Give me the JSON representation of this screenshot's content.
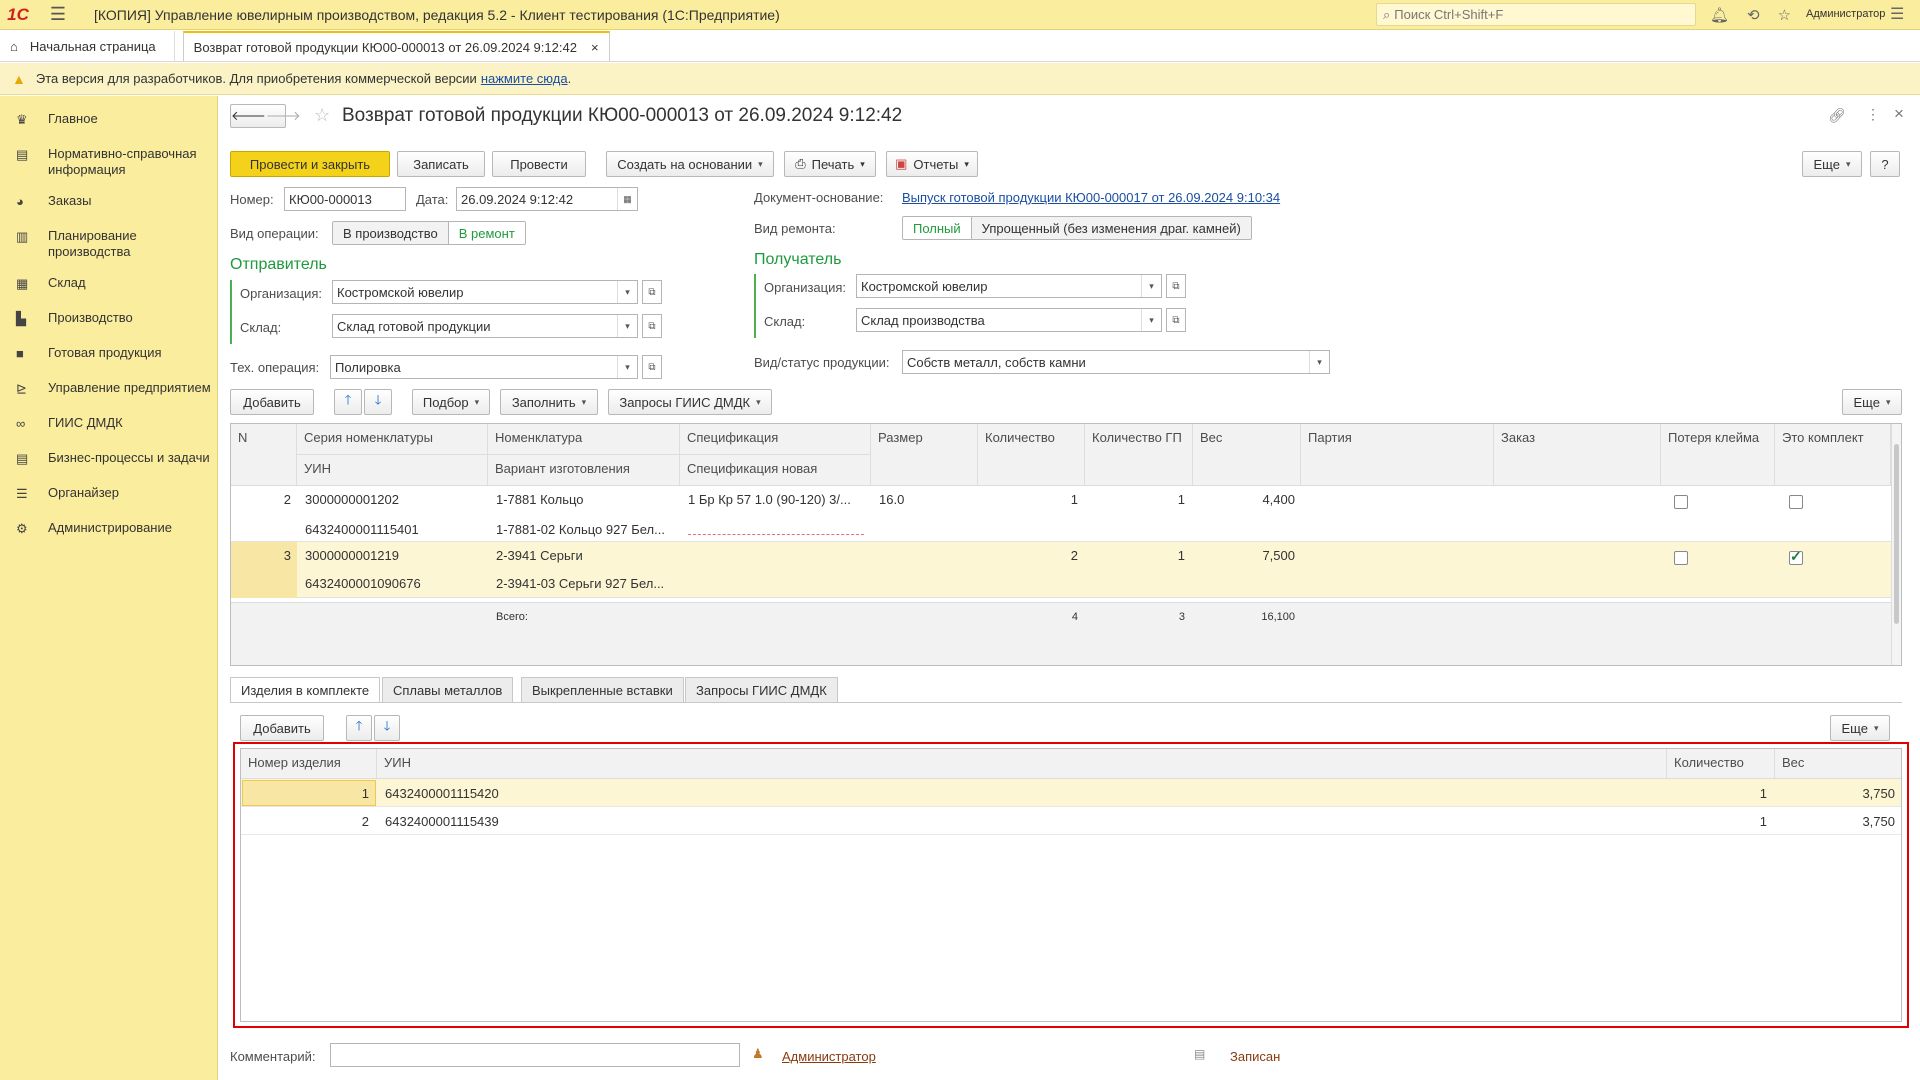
{
  "app": {
    "logo": "1С",
    "title": "[КОПИЯ] Управление ювелирным производством, редакция 5.2  - Клиент тестирования (1С:Предприятие)",
    "search_placeholder": "Поиск Ctrl+Shift+F",
    "user": "Администратор"
  },
  "tabs": {
    "home": "Начальная страница",
    "doc": "Возврат готовой продукции КЮ00-000013 от 26.09.2024 9:12:42"
  },
  "warning": {
    "text": "Эта версия для разработчиков. Для приобретения коммерческой версии",
    "link": "нажмите сюда",
    "dot": "."
  },
  "sidebar": {
    "items": [
      {
        "label": "Главное",
        "icon": "crown-icon"
      },
      {
        "label": "Нормативно-справочная информация",
        "icon": "book-icon"
      },
      {
        "label": "Заказы",
        "icon": "pie-icon"
      },
      {
        "label": "Планирование производства",
        "icon": "clipboard-icon"
      },
      {
        "label": "Склад",
        "icon": "grid-icon"
      },
      {
        "label": "Производство",
        "icon": "factory-icon"
      },
      {
        "label": "Готовая продукция",
        "icon": "bag-icon"
      },
      {
        "label": "Управление предприятием",
        "icon": "chart-icon"
      },
      {
        "label": "ГИИС ДМДК",
        "icon": "link-icon"
      },
      {
        "label": "Бизнес-процессы и задачи",
        "icon": "building-icon"
      },
      {
        "label": "Органайзер",
        "icon": "list-icon"
      },
      {
        "label": "Администрирование",
        "icon": "gear-icon"
      }
    ]
  },
  "doc": {
    "title": "Возврат готовой продукции КЮ00-000013 от 26.09.2024 9:12:42"
  },
  "toolbar": {
    "post_close": "Провести и закрыть",
    "save": "Записать",
    "post": "Провести",
    "create_based": "Создать на основании",
    "print": "Печать",
    "reports": "Отчеты",
    "more": "Еще",
    "help": "?"
  },
  "header": {
    "number_label": "Номер:",
    "number": "КЮ00-000013",
    "date_label": "Дата:",
    "date": "26.09.2024  9:12:42",
    "op_label": "Вид операции:",
    "op_options": [
      "В производство",
      "В ремонт"
    ],
    "base_label": "Документ-основание:",
    "base_link": "Выпуск готовой продукции КЮ00-000017 от 26.09.2024 9:10:34",
    "repair_label": "Вид ремонта:",
    "repair_options": [
      "Полный",
      "Упрощенный (без изменения драг. камней)"
    ]
  },
  "sender": {
    "title": "Отправитель",
    "org_label": "Организация:",
    "org": "Костромской ювелир",
    "wh_label": "Склад:",
    "wh": "Склад готовой продукции"
  },
  "receiver": {
    "title": "Получатель",
    "org_label": "Организация:",
    "org": "Костромской ювелир",
    "wh_label": "Склад:",
    "wh": "Склад производства"
  },
  "techop": {
    "label": "Тех. операция:",
    "value": "Полировка"
  },
  "prodstatus": {
    "label": "Вид/статус продукции:",
    "value": "Собств металл, собств камни"
  },
  "tabletoolbar": {
    "add": "Добавить",
    "select": "Подбор",
    "fill": "Заполнить",
    "requests": "Запросы ГИИС ДМДК",
    "more": "Еще"
  },
  "table": {
    "headers": {
      "n": "N",
      "series": "Серия номенклатуры",
      "uin": "УИН",
      "nomen": "Номенклатура",
      "variant": "Вариант изготовления",
      "spec": "Спецификация",
      "spec_new": "Спецификация новая",
      "size": "Размер",
      "qty": "Количество",
      "qty_gp": "Количество ГП",
      "weight": "Вес",
      "batch": "Партия",
      "order": "Заказ",
      "lost_mark": "Потеря клейма",
      "is_set": "Это комплект"
    },
    "rows": [
      {
        "n": "2",
        "series": "3000000001202",
        "uin": "6432400001115401",
        "nomen": "1-7881 Кольцо",
        "variant": "1-7881-02 Кольцо 927 Бел...",
        "spec": "1 Бр Кр 57 1.0 (90-120) 3/...",
        "size": "16.0",
        "qty": "1",
        "qty_gp": "1",
        "weight": "4,400"
      },
      {
        "n": "3",
        "series": "3000000001219",
        "uin": "6432400001090676",
        "nomen": "2-3941 Серьги",
        "variant": "2-3941-03 Серьги 927 Бел...",
        "spec": "",
        "size": "",
        "qty": "2",
        "qty_gp": "1",
        "weight": "7,500"
      }
    ],
    "total": {
      "label": "Всего:",
      "qty": "4",
      "qty_gp": "3",
      "weight": "16,100"
    }
  },
  "subtabs": [
    "Изделия в комплекте",
    "Сплавы металлов",
    "Выкрепленные вставки",
    "Запросы ГИИС ДМДК"
  ],
  "subtoolbar": {
    "add": "Добавить",
    "more": "Еще"
  },
  "subtable": {
    "headers": {
      "num": "Номер изделия",
      "uin": "УИН",
      "qty": "Количество",
      "weight": "Вес"
    },
    "rows": [
      {
        "num": "1",
        "uin": "6432400001115420",
        "qty": "1",
        "weight": "3,750"
      },
      {
        "num": "2",
        "uin": "6432400001115439",
        "qty": "1",
        "weight": "3,750"
      }
    ]
  },
  "footer": {
    "comment_label": "Комментарий:",
    "author": "Администратор",
    "status": "Записан"
  }
}
